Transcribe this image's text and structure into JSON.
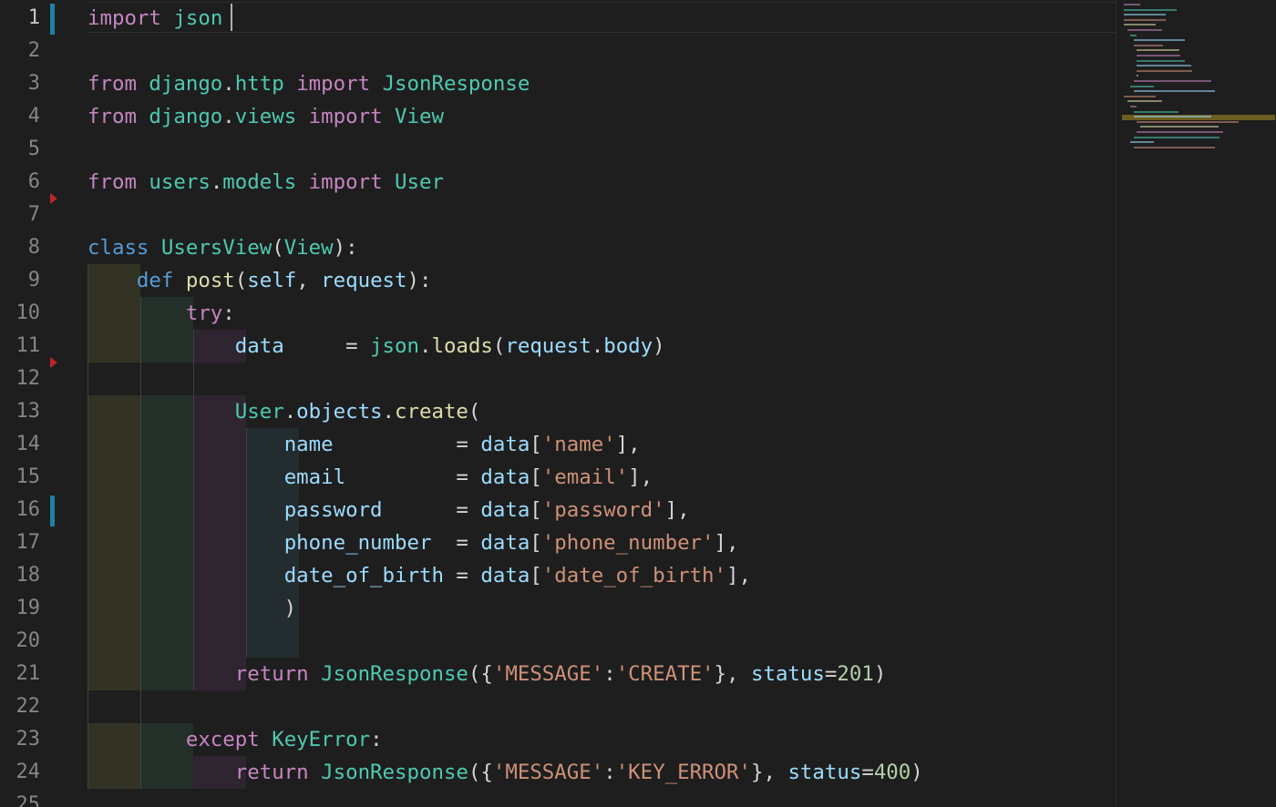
{
  "editor": {
    "line_numbers": [
      "1",
      "2",
      "3",
      "4",
      "5",
      "6",
      "7",
      "8",
      "9",
      "10",
      "11",
      "12",
      "13",
      "14",
      "15",
      "16",
      "17",
      "18",
      "19",
      "20",
      "21",
      "22",
      "23",
      "24",
      "25"
    ],
    "lines": [
      [
        [
          "k",
          "import"
        ],
        [
          "p",
          " "
        ],
        [
          "t",
          "json"
        ]
      ],
      [],
      [
        [
          "k",
          "from"
        ],
        [
          "p",
          " "
        ],
        [
          "t",
          "django"
        ],
        [
          "p",
          "."
        ],
        [
          "t",
          "http"
        ],
        [
          "p",
          " "
        ],
        [
          "k",
          "import"
        ],
        [
          "p",
          " "
        ],
        [
          "t",
          "JsonResponse"
        ]
      ],
      [
        [
          "k",
          "from"
        ],
        [
          "p",
          " "
        ],
        [
          "t",
          "django"
        ],
        [
          "p",
          "."
        ],
        [
          "t",
          "views"
        ],
        [
          "p",
          " "
        ],
        [
          "k",
          "import"
        ],
        [
          "p",
          " "
        ],
        [
          "t",
          "View"
        ]
      ],
      [],
      [
        [
          "k",
          "from"
        ],
        [
          "p",
          " "
        ],
        [
          "t",
          "users"
        ],
        [
          "p",
          "."
        ],
        [
          "t",
          "models"
        ],
        [
          "p",
          " "
        ],
        [
          "k",
          "import"
        ],
        [
          "p",
          " "
        ],
        [
          "t",
          "User"
        ]
      ],
      [],
      [
        [
          "b",
          "class"
        ],
        [
          "p",
          " "
        ],
        [
          "t",
          "UsersView"
        ],
        [
          "p",
          "("
        ],
        [
          "t",
          "View"
        ],
        [
          "p",
          "):"
        ]
      ],
      [
        [
          "p",
          "    "
        ],
        [
          "b",
          "def"
        ],
        [
          "p",
          " "
        ],
        [
          "f",
          "post"
        ],
        [
          "p",
          "("
        ],
        [
          "v",
          "self"
        ],
        [
          "p",
          ", "
        ],
        [
          "v",
          "request"
        ],
        [
          "p",
          "):"
        ]
      ],
      [
        [
          "p",
          "        "
        ],
        [
          "k",
          "try"
        ],
        [
          "p",
          ":"
        ]
      ],
      [
        [
          "p",
          "            "
        ],
        [
          "v",
          "data"
        ],
        [
          "p",
          "     = "
        ],
        [
          "t",
          "json"
        ],
        [
          "p",
          "."
        ],
        [
          "f",
          "loads"
        ],
        [
          "p",
          "("
        ],
        [
          "v",
          "request"
        ],
        [
          "p",
          "."
        ],
        [
          "v",
          "body"
        ],
        [
          "p",
          ")"
        ]
      ],
      [],
      [
        [
          "p",
          "            "
        ],
        [
          "t",
          "User"
        ],
        [
          "p",
          "."
        ],
        [
          "v",
          "objects"
        ],
        [
          "p",
          "."
        ],
        [
          "f",
          "create"
        ],
        [
          "p",
          "("
        ]
      ],
      [
        [
          "p",
          "                "
        ],
        [
          "v",
          "name"
        ],
        [
          "p",
          "          = "
        ],
        [
          "v",
          "data"
        ],
        [
          "p",
          "["
        ],
        [
          "s",
          "'name'"
        ],
        [
          "p",
          "],"
        ]
      ],
      [
        [
          "p",
          "                "
        ],
        [
          "v",
          "email"
        ],
        [
          "p",
          "         = "
        ],
        [
          "v",
          "data"
        ],
        [
          "p",
          "["
        ],
        [
          "s",
          "'email'"
        ],
        [
          "p",
          "],"
        ]
      ],
      [
        [
          "p",
          "                "
        ],
        [
          "v",
          "password"
        ],
        [
          "p",
          "      = "
        ],
        [
          "v",
          "data"
        ],
        [
          "p",
          "["
        ],
        [
          "s",
          "'password'"
        ],
        [
          "p",
          "],"
        ]
      ],
      [
        [
          "p",
          "                "
        ],
        [
          "v",
          "phone_number"
        ],
        [
          "p",
          "  = "
        ],
        [
          "v",
          "data"
        ],
        [
          "p",
          "["
        ],
        [
          "s",
          "'phone_number'"
        ],
        [
          "p",
          "],"
        ]
      ],
      [
        [
          "p",
          "                "
        ],
        [
          "v",
          "date_of_birth"
        ],
        [
          "p",
          " = "
        ],
        [
          "v",
          "data"
        ],
        [
          "p",
          "["
        ],
        [
          "s",
          "'date_of_birth'"
        ],
        [
          "p",
          "],"
        ]
      ],
      [
        [
          "p",
          "                )"
        ]
      ],
      [],
      [
        [
          "p",
          "            "
        ],
        [
          "k",
          "return"
        ],
        [
          "p",
          " "
        ],
        [
          "t",
          "JsonResponse"
        ],
        [
          "p",
          "({"
        ],
        [
          "s",
          "'MESSAGE'"
        ],
        [
          "p",
          ":"
        ],
        [
          "s",
          "'CREATE'"
        ],
        [
          "p",
          "}, "
        ],
        [
          "v",
          "status"
        ],
        [
          "p",
          "="
        ],
        [
          "n",
          "201"
        ],
        [
          "p",
          ")"
        ]
      ],
      [],
      [
        [
          "p",
          "        "
        ],
        [
          "k",
          "except"
        ],
        [
          "p",
          " "
        ],
        [
          "t",
          "KeyError"
        ],
        [
          "p",
          ":"
        ]
      ],
      [
        [
          "p",
          "            "
        ],
        [
          "k",
          "return"
        ],
        [
          "p",
          " "
        ],
        [
          "t",
          "JsonResponse"
        ],
        [
          "p",
          "({"
        ],
        [
          "s",
          "'MESSAGE'"
        ],
        [
          "p",
          ":"
        ],
        [
          "s",
          "'KEY_ERROR'"
        ],
        [
          "p",
          "}, "
        ],
        [
          "v",
          "status"
        ],
        [
          "p",
          "="
        ],
        [
          "n",
          "400"
        ],
        [
          "p",
          ")"
        ]
      ],
      []
    ],
    "modified_lines": [
      1,
      16
    ],
    "deleted_markers": [
      7,
      12
    ]
  },
  "minimap": {
    "lines": [
      "import json",
      "from django.http import JsonResponse",
      "from django.views import View",
      "from users.models import User",
      "class UsersView(View):",
      "    def post(self, request):",
      "        try:",
      "            data     = json.loads(request.body)",
      "            User.objects.create(",
      "                name          = data['name'],",
      "                email         = data['email'],",
      "                password      = data['password'],",
      "                phone_number  = data['phone_number'],",
      "                date_of_birth = data['date_of_birth'],",
      "                )",
      "            return JsonResponse({'MESSAGE':'CREATE'}, status=201)",
      "        except KeyError:",
      "            return JsonResponse({'MESSAGE':'KEY_ERROR'}, status=400)",
      "class LoginView(View):",
      "    def post(self, request):",
      "        try:",
      "            data = json.loads(request.body)",
      "            if User.objects.filter(email=data['email']).exists():",
      "                if User.objects.get(email=data['email']).password == data['password']:",
      "                    return JsonResponse({'MESSAGE':'SUCCESS'}, status=200)",
      "                return JsonResponse({'MESSAGE':'INVALID_USER'}, status=401)",
      "            return JsonResponse({'MESSAGE':'INVALID_USER'}, status=401)",
      "        except KeyError:",
      "            return JsonResponse({'MESSAGE':'KEY_ERROR'}, status=400)"
    ]
  },
  "colors": {
    "keyword": "#c586c0",
    "storage": "#569cd6",
    "type": "#4ec9b0",
    "function": "#dcdcaa",
    "variable": "#9cdcfe",
    "string": "#ce9178",
    "number": "#b5cea8",
    "punctuation": "#d4d4d4"
  }
}
